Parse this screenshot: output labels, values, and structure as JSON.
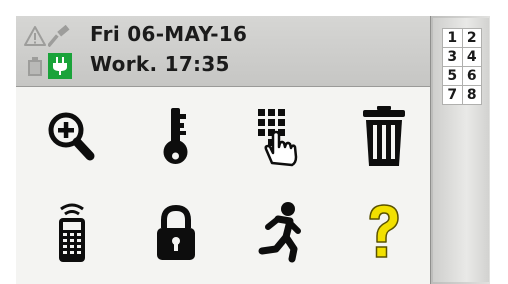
{
  "header": {
    "date_line": "Fri 06-MAY-16",
    "status_line": "Work. 17:35"
  },
  "status_icons": [
    {
      "name": "warning-icon",
      "state": "inactive"
    },
    {
      "name": "hammer-icon",
      "state": "inactive"
    },
    {
      "name": "battery-icon",
      "state": "inactive"
    },
    {
      "name": "power-plug-icon",
      "state": "active",
      "color": "#1aa33a"
    }
  ],
  "menu": [
    {
      "name": "zoom-in-icon"
    },
    {
      "name": "key-icon"
    },
    {
      "name": "keypad-touch-icon"
    },
    {
      "name": "trash-icon"
    },
    {
      "name": "remote-control-icon"
    },
    {
      "name": "padlock-icon"
    },
    {
      "name": "running-man-icon"
    },
    {
      "name": "help-question-icon",
      "color": "#f2e000"
    }
  ],
  "sidebar": {
    "numbers": [
      [
        "1",
        "2"
      ],
      [
        "3",
        "4"
      ],
      [
        "5",
        "6"
      ],
      [
        "7",
        "8"
      ]
    ]
  }
}
